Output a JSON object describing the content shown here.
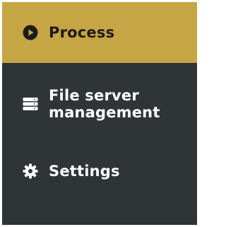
{
  "sidebar": {
    "colors": {
      "background": "#2f3537",
      "active_background": "#c6a545",
      "active_text": "#1b1b1b",
      "text": "#ffffff"
    },
    "items": [
      {
        "label": "Process",
        "icon": "play-circle-icon",
        "active": true
      },
      {
        "label_line1": "File server",
        "label_line2": "management",
        "icon": "server-icon",
        "active": false
      },
      {
        "label": "Settings",
        "icon": "gear-icon",
        "active": false
      }
    ]
  }
}
